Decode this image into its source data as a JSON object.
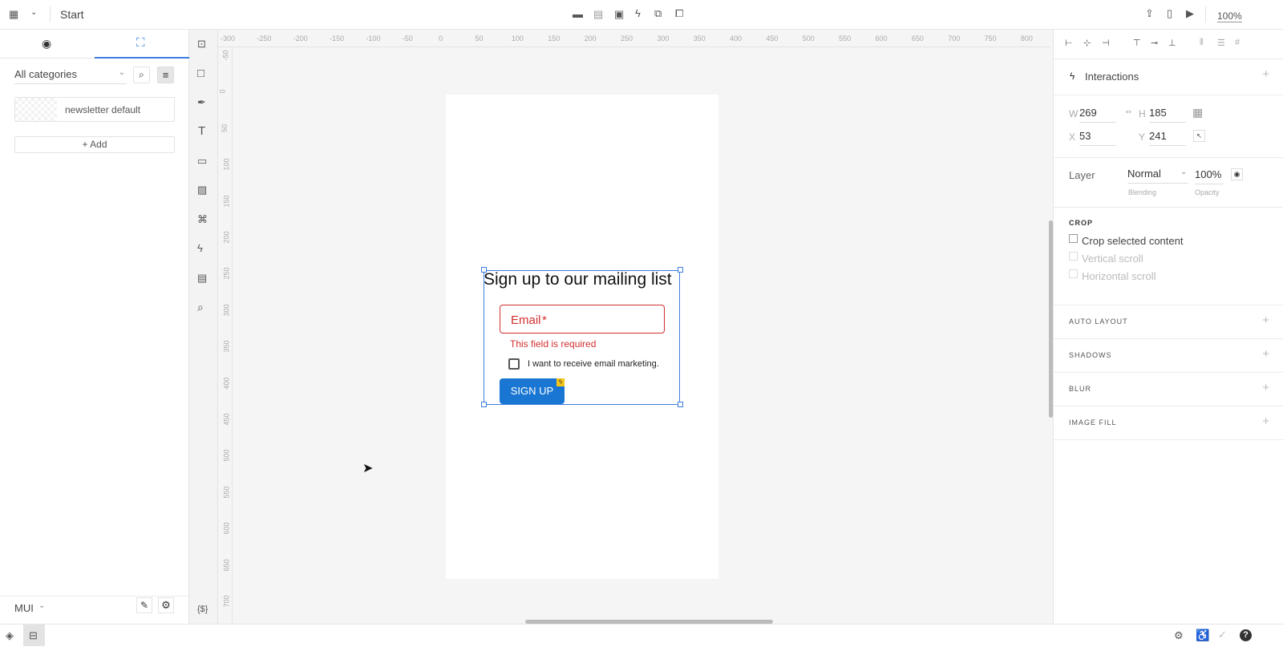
{
  "topbar": {
    "title": "Start",
    "zoom": "100%"
  },
  "left": {
    "category": "All categories",
    "item": "newsletter default",
    "add": "+ Add",
    "library": "MUI"
  },
  "ruler": {
    "h": [
      "-300",
      "-250",
      "-200",
      "-150",
      "-100",
      "-50",
      "0",
      "50",
      "100",
      "150",
      "200",
      "250",
      "300",
      "350",
      "400",
      "450",
      "500",
      "550",
      "600",
      "650",
      "700",
      "750",
      "800"
    ],
    "v": [
      "-50",
      "0",
      "50",
      "100",
      "150",
      "200",
      "250",
      "300",
      "350",
      "400",
      "450",
      "500",
      "550",
      "600",
      "650",
      "700"
    ]
  },
  "tools": {
    "variables": "{$}"
  },
  "form": {
    "title": "Sign up to our mailing list",
    "email_label": "Email",
    "required": "*",
    "error": "This field is required",
    "checkbox": "I want to receive email marketing.",
    "button": "SIGN UP"
  },
  "right": {
    "interactions": "Interactions",
    "w_label": "W",
    "w": "269",
    "h_label": "H",
    "h": "185",
    "x_label": "X",
    "x": "53",
    "y_label": "Y",
    "y": "241",
    "layer": "Layer",
    "blending": "Normal",
    "blending_label": "Blending",
    "opacity": "100%",
    "opacity_label": "Opacity",
    "crop": "CROP",
    "crop_selected": "Crop selected content",
    "vscroll": "Vertical scroll",
    "hscroll": "Horizontal scroll",
    "auto_layout": "AUTO LAYOUT",
    "shadows": "SHADOWS",
    "blur": "BLUR",
    "image_fill": "IMAGE FILL"
  },
  "colors": {
    "accent": "#3b7ddd",
    "error": "#d32f2f",
    "button": "#1976d2"
  }
}
